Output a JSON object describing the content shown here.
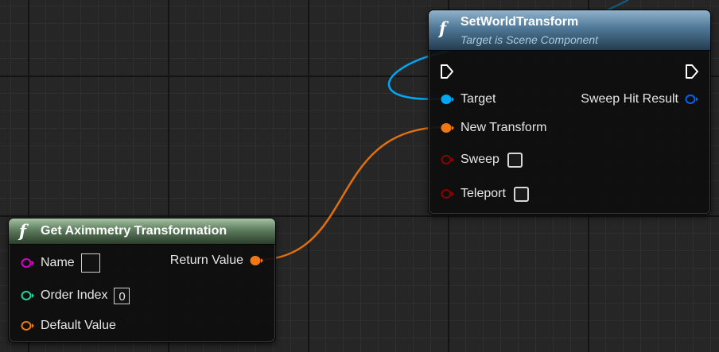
{
  "colors": {
    "exec": "#ffffff",
    "object_pin": "#00a8f4",
    "struct_pin": "#f07814",
    "bool_pin": "#8c0000",
    "string_pin": "#d800c8",
    "int_pin": "#1ed49a",
    "hit_result_pin": "#0064f0"
  },
  "set_world_transform": {
    "icon": "function-icon",
    "title": "SetWorldTransform",
    "subtitle": "Target is Scene Component",
    "inputs": {
      "target": "Target",
      "new_transform": "New Transform",
      "sweep": "Sweep",
      "teleport": "Teleport"
    },
    "outputs": {
      "sweep_hit_result": "Sweep Hit Result"
    }
  },
  "get_aximmetry_transformation": {
    "icon": "function-icon",
    "title": "Get Aximmetry Transformation",
    "inputs": {
      "name": "Name",
      "name_value": "",
      "order_index": "Order Index",
      "order_index_value": "0",
      "default_value": "Default Value"
    },
    "outputs": {
      "return_value": "Return Value"
    }
  }
}
